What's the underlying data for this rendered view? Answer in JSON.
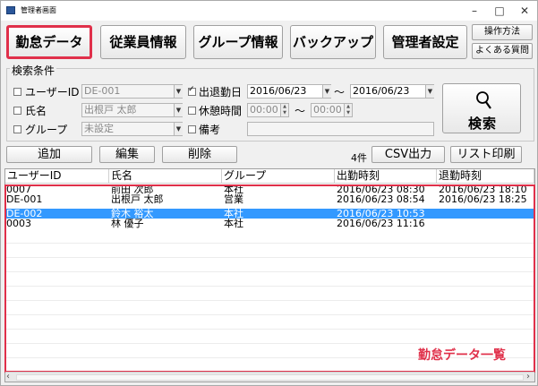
{
  "window": {
    "title": "管理者画面",
    "minimize_glyph": "–",
    "maximize_glyph": "□",
    "close_glyph": "✕"
  },
  "nav": {
    "attendance": "勤怠データ",
    "employees": "従業員情報",
    "groups": "グループ情報",
    "backup": "バックアップ",
    "admin_settings": "管理者設定",
    "help": "操作方法",
    "faq": "よくある質問"
  },
  "search": {
    "legend": "検索条件",
    "user_id_label": "ユーザーID",
    "user_id_value": "DE-001",
    "name_label": "氏名",
    "name_value": "出根戸 太郎",
    "group_label": "グループ",
    "group_value": "未設定",
    "date_label": "出退勤日",
    "date_from": "2016/06/23",
    "date_to": "2016/06/23",
    "range_sep": "～",
    "break_label": "休憩時間",
    "break_from": "00:00",
    "break_to": "00:00",
    "memo_label": "備考",
    "memo_value": "",
    "search_button": "検索"
  },
  "actions": {
    "add": "追加",
    "edit": "編集",
    "delete": "削除",
    "count": "4件",
    "csv": "CSV出力",
    "print": "リスト印刷"
  },
  "table": {
    "headers": [
      "ユーザーID",
      "氏名",
      "グループ",
      "出勤時刻",
      "退勤時刻"
    ],
    "rows": [
      {
        "id": "0007",
        "name": "前田 次郎",
        "group": "本社",
        "in": "2016/06/23 08:30",
        "out": "2016/06/23 18:10"
      },
      {
        "id": "DE-001",
        "name": "出根戸 太郎",
        "group": "営業",
        "in": "2016/06/23 08:54",
        "out": "2016/06/23 18:25"
      },
      {
        "id": "DE-002",
        "name": "鈴木 裕太",
        "group": "本社",
        "in": "2016/06/23 10:53",
        "out": ""
      },
      {
        "id": "0003",
        "name": "林 優子",
        "group": "本社",
        "in": "2016/06/23 11:16",
        "out": ""
      }
    ],
    "selected_row": 2,
    "overlay_label": "勤怠データ一覧"
  },
  "colors": {
    "highlight": "#e0304a",
    "selection": "#3399ff"
  }
}
